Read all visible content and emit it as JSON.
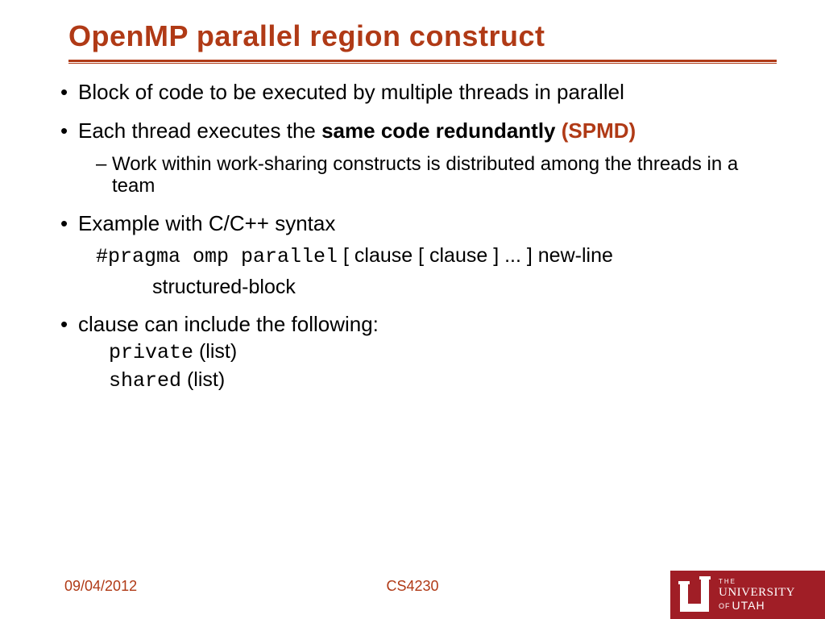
{
  "title": "OpenMP parallel region construct",
  "bullets": {
    "b1": "Block of code to be executed by multiple threads in parallel",
    "b2_a": "Each thread executes the ",
    "b2_b": "same code redundantly",
    "b2_c": " (SPMD)",
    "b2_sub": "Work within work-sharing constructs is distributed among the threads in a team",
    "b3": "Example with C/C++ syntax",
    "b3_code": "#pragma omp parallel",
    "b3_tail": " [ clause [ clause ] ... ] new-line",
    "b3_block": "structured-block",
    "b4": "clause can include the following:",
    "b4_c1a": "private",
    "b4_c1b": " (list)",
    "b4_c2a": "shared",
    "b4_c2b": " (list)"
  },
  "footer": {
    "date": "09/04/2012",
    "course": "CS4230"
  },
  "logo": {
    "the": "THE",
    "university": "UNIVERSITY",
    "of": "OF",
    "utah": "UTAH"
  }
}
